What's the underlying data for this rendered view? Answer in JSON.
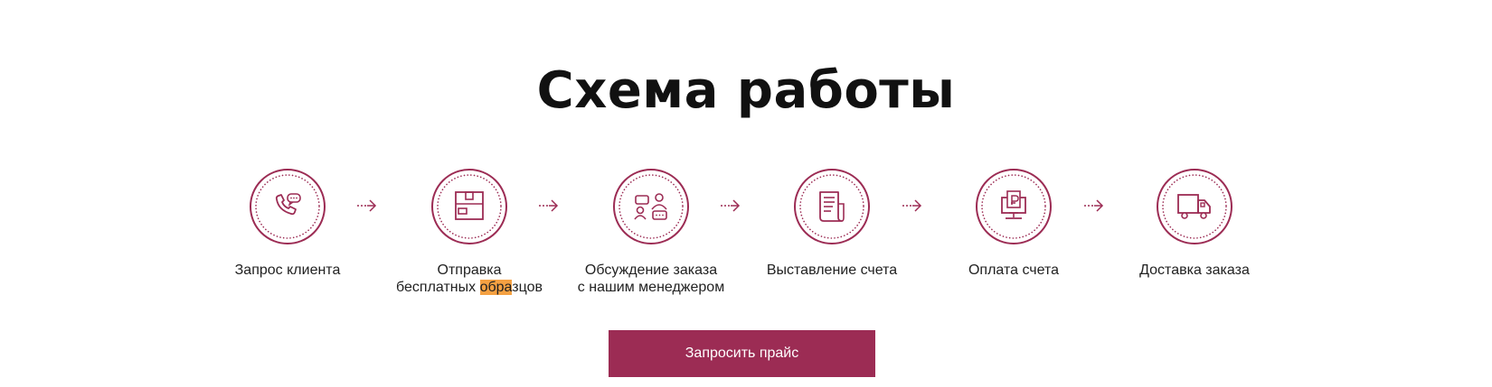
{
  "section": {
    "title": "Схема работы"
  },
  "steps": [
    {
      "label": "Запрос клиента",
      "icon": "phone-chat-icon"
    },
    {
      "label": "Отправка\nбесплатных ",
      "label_highlight": "обра",
      "label_tail": "зцов",
      "icon": "box-icon"
    },
    {
      "label": "Обсуждение заказа\nс нашим менеджером",
      "icon": "manager-meeting-icon"
    },
    {
      "label": "Выставление счета",
      "icon": "invoice-icon"
    },
    {
      "label": "Оплата счета",
      "icon": "payment-terminal-icon"
    },
    {
      "label": "Доставка заказа",
      "icon": "delivery-truck-icon"
    }
  ],
  "cta": {
    "label": "Запросить прайс"
  },
  "colors": {
    "accent": "#9c2c54",
    "highlight": "#f5a142"
  }
}
